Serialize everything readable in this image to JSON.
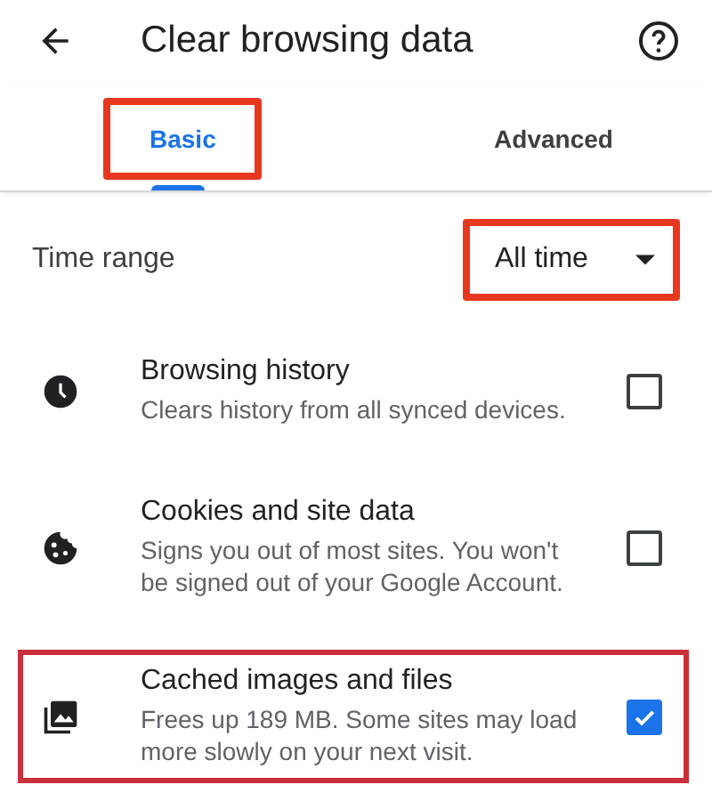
{
  "header": {
    "title": "Clear browsing data"
  },
  "tabs": [
    {
      "label": "Basic",
      "selected": true,
      "highlighted": true
    },
    {
      "label": "Advanced",
      "selected": false,
      "highlighted": false
    }
  ],
  "time_range": {
    "label": "Time range",
    "value": "All time",
    "highlighted": true
  },
  "items": [
    {
      "title": "Browsing history",
      "description": "Clears history from all synced devices.",
      "checked": false,
      "highlighted": false
    },
    {
      "title": "Cookies and site data",
      "description": "Signs you out of most sites. You won't be signed out of your Google Account.",
      "checked": false,
      "highlighted": false
    },
    {
      "title": "Cached images and files",
      "description": "Frees up 189 MB. Some sites may load more slowly on your next visit.",
      "checked": true,
      "highlighted": true
    }
  ]
}
